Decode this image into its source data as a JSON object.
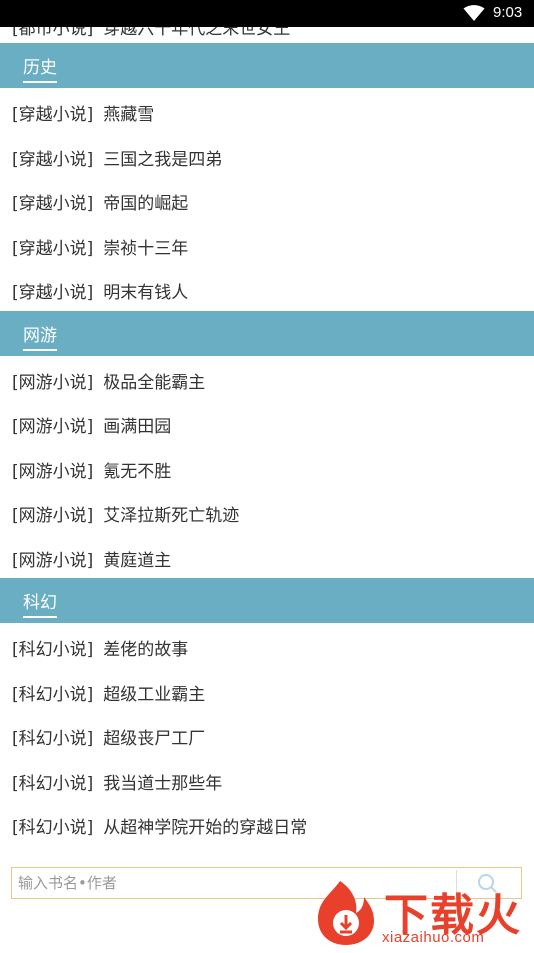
{
  "status_bar": {
    "time": "9:03"
  },
  "top_partial_item": {
    "category": "[都市小说]",
    "title": "穿越六十年代之末世女王"
  },
  "sections": [
    {
      "title": "历史",
      "items": [
        {
          "category": "[穿越小说]",
          "title": "燕藏雪"
        },
        {
          "category": "[穿越小说]",
          "title": "三国之我是四弟"
        },
        {
          "category": "[穿越小说]",
          "title": "帝国的崛起"
        },
        {
          "category": "[穿越小说]",
          "title": "崇祯十三年"
        },
        {
          "category": "[穿越小说]",
          "title": "明末有钱人"
        }
      ]
    },
    {
      "title": "网游",
      "items": [
        {
          "category": "[网游小说]",
          "title": "极品全能霸主"
        },
        {
          "category": "[网游小说]",
          "title": "画满田园"
        },
        {
          "category": "[网游小说]",
          "title": "氪无不胜"
        },
        {
          "category": "[网游小说]",
          "title": "艾泽拉斯死亡轨迹"
        },
        {
          "category": "[网游小说]",
          "title": "黄庭道主"
        }
      ]
    },
    {
      "title": "科幻",
      "items": [
        {
          "category": "[科幻小说]",
          "title": "差佬的故事"
        },
        {
          "category": "[科幻小说]",
          "title": "超级工业霸主"
        },
        {
          "category": "[科幻小说]",
          "title": "超级丧尸工厂"
        },
        {
          "category": "[科幻小说]",
          "title": "我当道士那些年"
        },
        {
          "category": "[科幻小说]",
          "title": "从超神学院开始的穿越日常"
        }
      ]
    }
  ],
  "search": {
    "placeholder": "输入书名•作者",
    "icon": "search-icon"
  },
  "watermark": {
    "brand": "下载火",
    "url": "xiazaihuo.com"
  },
  "colors": {
    "header_bg": "#6aaec4",
    "text": "#333333",
    "search_border": "#e6c98a",
    "watermark_red": "#e8402a"
  }
}
